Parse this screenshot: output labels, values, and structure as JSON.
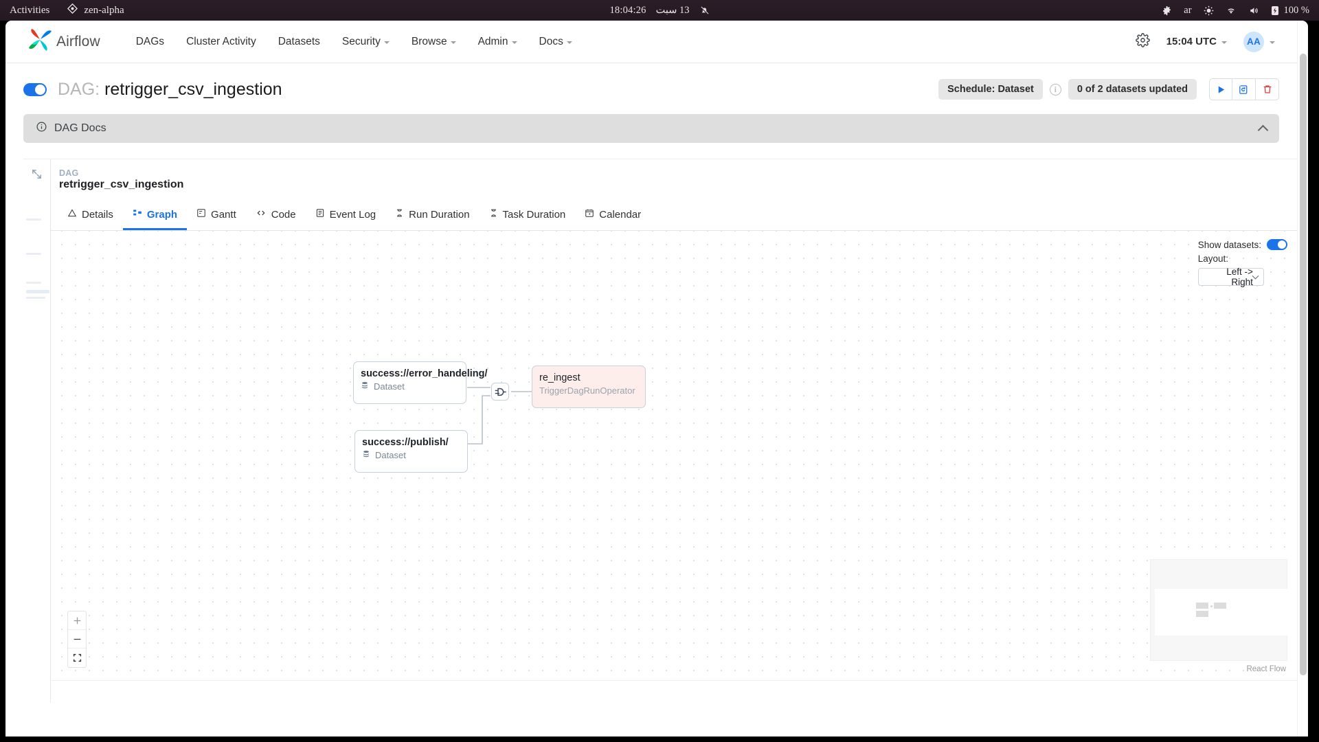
{
  "os": {
    "activities": "Activities",
    "app_name": "zen-alpha",
    "clock": "18:04:26",
    "date": "13 سبت",
    "keyboard_layout": "ar",
    "battery": "100 %",
    "icons": [
      "notifications-muted-icon",
      "settings-icon",
      "brightness-icon",
      "wifi-icon",
      "volume-icon",
      "battery-icon"
    ]
  },
  "navbar": {
    "brand": "Airflow",
    "items": [
      {
        "label": "DAGs",
        "has_caret": false
      },
      {
        "label": "Cluster Activity",
        "has_caret": false
      },
      {
        "label": "Datasets",
        "has_caret": false
      },
      {
        "label": "Security",
        "has_caret": true
      },
      {
        "label": "Browse",
        "has_caret": true
      },
      {
        "label": "Admin",
        "has_caret": true
      },
      {
        "label": "Docs",
        "has_caret": true
      }
    ],
    "timezone": "15:04 UTC",
    "avatar_initials": "AA"
  },
  "dag_header": {
    "prefix": "DAG:",
    "name": "retrigger_csv_ingestion",
    "toggle_on": true,
    "schedule_badge": "Schedule: Dataset",
    "datasets_badge": "0 of 2 datasets updated",
    "actions": [
      "trigger-dag-button",
      "clear-dag-button",
      "delete-dag-button"
    ]
  },
  "docs_accordion": {
    "label": "DAG Docs",
    "expanded": true
  },
  "detail_panel": {
    "kicker": "DAG",
    "name": "retrigger_csv_ingestion",
    "tabs": [
      {
        "label": "Details",
        "icon": "alert-triangle-icon",
        "active": false
      },
      {
        "label": "Graph",
        "icon": "graph-icon",
        "active": true
      },
      {
        "label": "Gantt",
        "icon": "gantt-icon",
        "active": false
      },
      {
        "label": "Code",
        "icon": "code-icon",
        "active": false
      },
      {
        "label": "Event Log",
        "icon": "list-icon",
        "active": false
      },
      {
        "label": "Run Duration",
        "icon": "hourglass-icon",
        "active": false
      },
      {
        "label": "Task Duration",
        "icon": "hourglass-icon",
        "active": false
      },
      {
        "label": "Calendar",
        "icon": "calendar-icon",
        "active": false
      }
    ]
  },
  "graph": {
    "show_datasets_label": "Show datasets:",
    "show_datasets_on": true,
    "layout_label": "Layout:",
    "layout_value": "Left -> Right",
    "attribution": "React Flow",
    "nodes": [
      {
        "id": "ds1",
        "title": "success://error_handeling/",
        "subtitle": "Dataset",
        "type": "dataset"
      },
      {
        "id": "ds2",
        "title": "success://publish/",
        "subtitle": "Dataset",
        "type": "dataset"
      },
      {
        "id": "t1",
        "title": "re_ingest",
        "subtitle": "TriggerDagRunOperator",
        "type": "task",
        "state": "failed"
      }
    ],
    "join_node": "and-gate-icon",
    "zoom_controls": [
      "zoom-in",
      "zoom-out",
      "fit-view"
    ]
  }
}
